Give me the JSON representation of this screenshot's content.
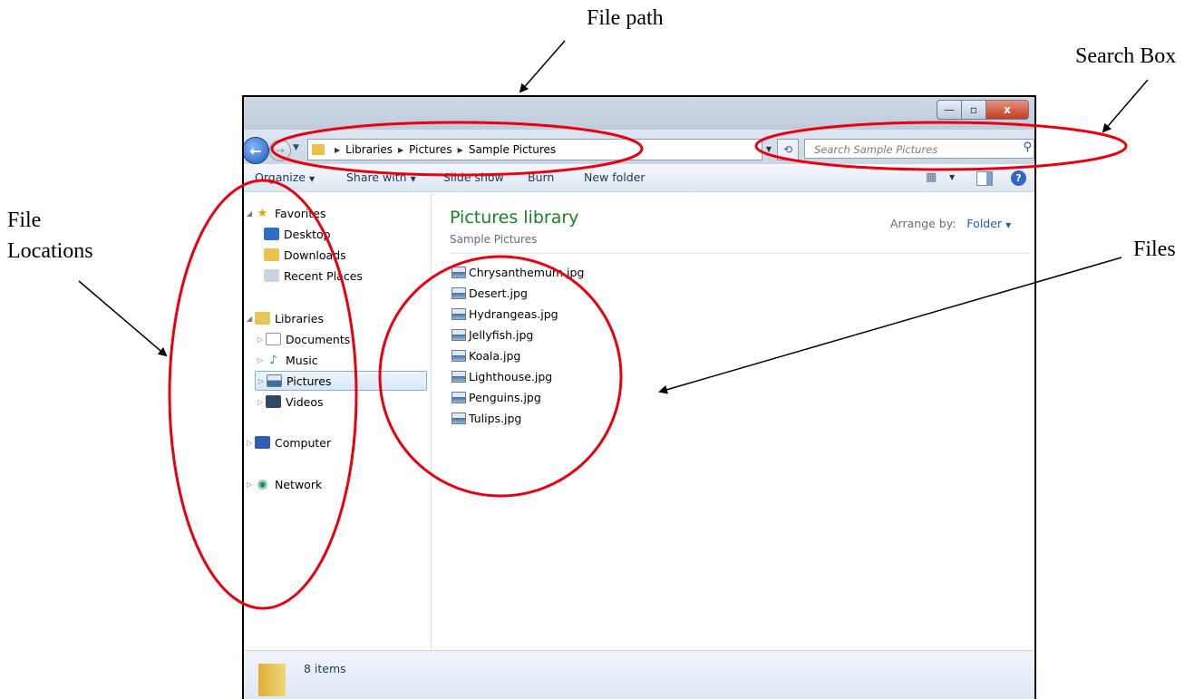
{
  "callouts": {
    "file_path": "File path",
    "search_box": "Search Box",
    "file_locations_line1": "File",
    "file_locations_line2": "Locations",
    "files": "Files"
  },
  "window": {
    "buttons": {
      "minimize": "—",
      "maximize": "▫",
      "close": "x"
    }
  },
  "navbar": {
    "address": [
      "Libraries",
      "Pictures",
      "Sample Pictures"
    ],
    "search_placeholder": "Search Sample Pictures"
  },
  "toolbar": {
    "organize": "Organize",
    "share_with": "Share with",
    "slide_show": "Slide show",
    "burn": "Burn",
    "new_folder": "New folder"
  },
  "nav_pane": {
    "favorites": {
      "label": "Favorites",
      "items": [
        "Desktop",
        "Downloads",
        "Recent Places"
      ]
    },
    "libraries": {
      "label": "Libraries",
      "items": [
        "Documents",
        "Music",
        "Pictures",
        "Videos"
      ]
    },
    "computer": "Computer",
    "network": "Network",
    "selected": "Pictures"
  },
  "content": {
    "title": "Pictures library",
    "subtitle": "Sample Pictures",
    "arrange_label": "Arrange by:",
    "arrange_value": "Folder",
    "files": [
      "Chrysanthemum.jpg",
      "Desert.jpg",
      "Hydrangeas.jpg",
      "Jellyfish.jpg",
      "Koala.jpg",
      "Lighthouse.jpg",
      "Penguins.jpg",
      "Tulips.jpg"
    ]
  },
  "status": {
    "count": "8 items"
  },
  "colors": {
    "annotation": "#e8000f",
    "library_title": "#1e7e27",
    "link": "#1f5fb8"
  }
}
